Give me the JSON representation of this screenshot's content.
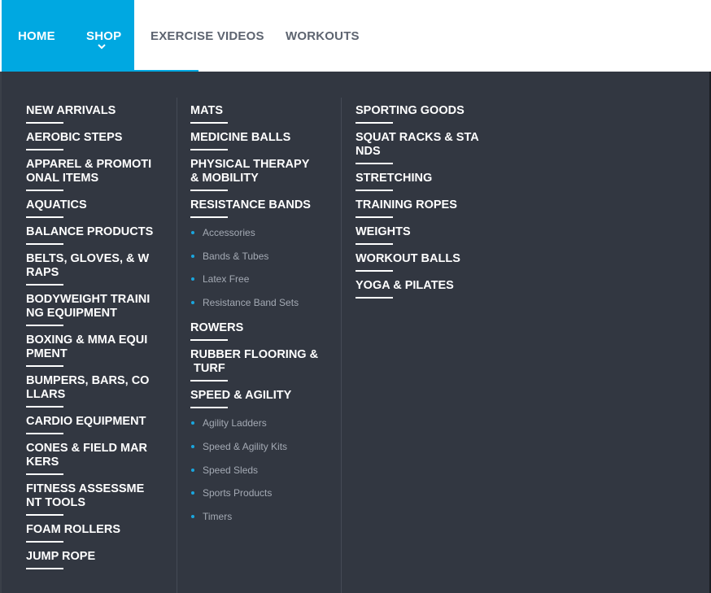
{
  "nav": {
    "items": [
      "HOME",
      "SHOP",
      "EXERCISE VIDEOS",
      "WORKOUTS"
    ],
    "active_color": "#00a8e1"
  },
  "menu": {
    "col1": [
      {
        "label": "NEW ARRIVALS"
      },
      {
        "label": "AEROBIC STEPS"
      },
      {
        "label": "APPAREL & PROMOTI\nONAL ITEMS"
      },
      {
        "label": "AQUATICS"
      },
      {
        "label": "BALANCE PRODUCTS"
      },
      {
        "label": "BELTS, GLOVES, & W\nRAPS"
      },
      {
        "label": "BODYWEIGHT TRAINI\nNG EQUIPMENT"
      },
      {
        "label": "BOXING & MMA EQUI\nPMENT"
      },
      {
        "label": "BUMPERS, BARS, CO\nLLARS"
      },
      {
        "label": "CARDIO EQUIPMENT"
      },
      {
        "label": "CONES & FIELD MAR\nKERS"
      },
      {
        "label": "FITNESS ASSESSME\nNT TOOLS"
      },
      {
        "label": "FOAM ROLLERS"
      },
      {
        "label": "JUMP ROPE"
      }
    ],
    "col2": [
      {
        "label": "MATS"
      },
      {
        "label": "MEDICINE BALLS"
      },
      {
        "label": "PHYSICAL THERAPY\n& MOBILITY"
      },
      {
        "label": "RESISTANCE BANDS",
        "subs": [
          "Accessories",
          "Bands & Tubes",
          "Latex Free",
          "Resistance Band Sets"
        ]
      },
      {
        "label": "ROWERS"
      },
      {
        "label": "RUBBER FLOORING &\n TURF"
      },
      {
        "label": "SPEED & AGILITY",
        "subs": [
          "Agility Ladders",
          "Speed & Agility Kits",
          "Speed Sleds",
          "Sports Products",
          "Timers"
        ]
      }
    ],
    "col3": [
      {
        "label": "SPORTING GOODS"
      },
      {
        "label": "SQUAT RACKS & STA\nNDS"
      },
      {
        "label": "STRETCHING"
      },
      {
        "label": "TRAINING ROPES"
      },
      {
        "label": "WEIGHTS"
      },
      {
        "label": "WORKOUT BALLS"
      },
      {
        "label": "YOGA & PILATES"
      }
    ]
  }
}
